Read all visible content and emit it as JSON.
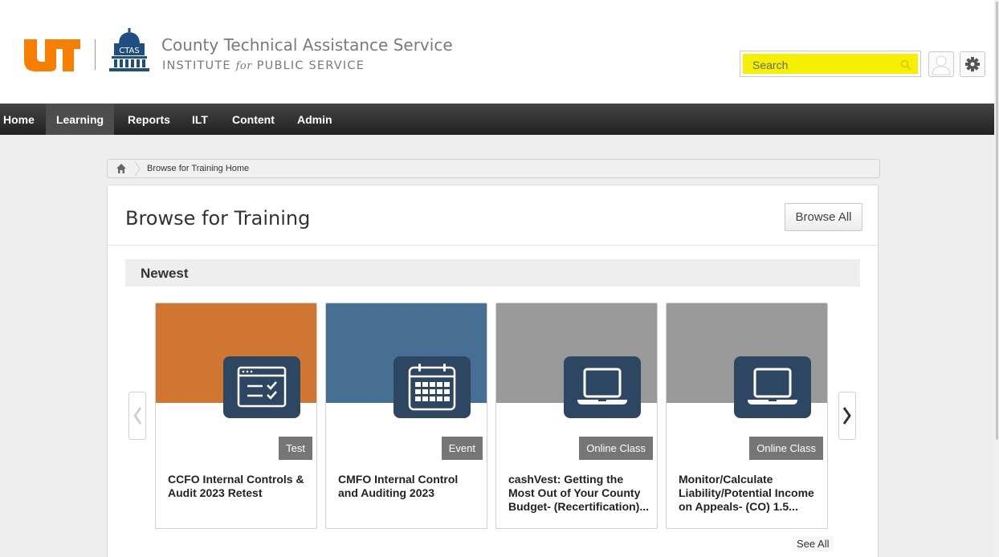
{
  "header": {
    "org_name": "County Technical Assistance Service",
    "org_sub_1": "INSTITUTE",
    "org_sub_for": "for",
    "org_sub_2": "PUBLIC SERVICE",
    "ut_logo_text": "UT",
    "ctas_logo_text": "CTAS",
    "search_placeholder": "Search",
    "search_highlight_color": "#f4f000"
  },
  "nav": {
    "items": [
      {
        "label": "Home"
      },
      {
        "label": "Learning",
        "active": true
      },
      {
        "label": "Reports"
      },
      {
        "label": "ILT"
      },
      {
        "label": "Content"
      },
      {
        "label": "Admin"
      }
    ]
  },
  "breadcrumb": {
    "current": "Browse for Training Home"
  },
  "main": {
    "title": "Browse for Training",
    "browse_all_label": "Browse All",
    "section_title": "Newest",
    "see_all_label": "See All"
  },
  "cards": [
    {
      "type": "Test",
      "title": "CCFO Internal Controls & Audit 2023 Retest",
      "color": "#d07633",
      "icon": "test-checklist-icon"
    },
    {
      "type": "Event",
      "title": "CMFO Internal Control and Auditing 2023",
      "color": "#476f93",
      "icon": "calendar-icon"
    },
    {
      "type": "Online Class",
      "title": "cashVest: Getting the Most Out of Your County Budget- (Recertification)...",
      "color": "#9a9a9a",
      "icon": "laptop-icon"
    },
    {
      "type": "Online Class",
      "title": "Monitor/Calculate Liability/Potential Income on Appeals- (CO) 1.5...",
      "color": "#9a9a9a",
      "icon": "laptop-icon"
    }
  ],
  "colors": {
    "ut_orange": "#f77f00",
    "ctas_blue": "#1f4f80",
    "icon_tile": "#2d4763",
    "navbar": "#333333"
  }
}
